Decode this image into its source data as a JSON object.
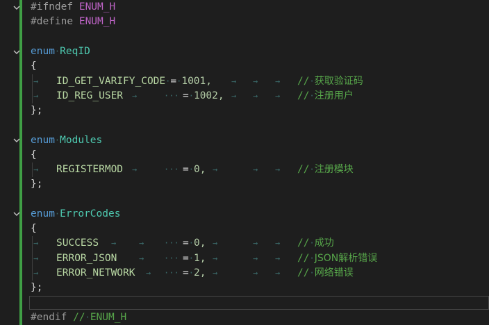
{
  "editor": {
    "colors": {
      "background": "#1e1e1e",
      "change_bar": "#3f9f45",
      "keyword": "#569cd6",
      "type": "#4ec9b0",
      "comment": "#57a64a",
      "macro": "#bd63c5"
    }
  },
  "lines": {
    "l1": {
      "d": "#ifndef",
      "name": "ENUM_H"
    },
    "l2": {
      "d": "#define",
      "name": "ENUM_H"
    },
    "l4": {
      "kw": "enum",
      "name": "ReqID"
    },
    "l5": {
      "t": "{"
    },
    "l6": {
      "name": "ID_GET_VARIFY_CODE",
      "eq": "=",
      "val": "1001,",
      "c1": "//",
      "c2": "获取验证码"
    },
    "l7": {
      "name": "ID_REG_USER",
      "eq": "=",
      "val": "1002,",
      "c1": "//",
      "c2": "注册用户"
    },
    "l8": {
      "t": "};"
    },
    "l10": {
      "kw": "enum",
      "name": "Modules"
    },
    "l11": {
      "t": "{"
    },
    "l12": {
      "name": "REGISTERMOD",
      "eq": "=",
      "val": "0,",
      "c1": "//",
      "c2": "注册模块"
    },
    "l13": {
      "t": "};"
    },
    "l15": {
      "kw": "enum",
      "name": "ErrorCodes"
    },
    "l16": {
      "t": "{"
    },
    "l17": {
      "name": "SUCCESS",
      "eq": "=",
      "val": "0,",
      "c1": "//",
      "c2": "成功"
    },
    "l18": {
      "name": "ERROR_JSON",
      "eq": "=",
      "val": "1,",
      "c1": "//",
      "c2": "JSON解析错误"
    },
    "l19": {
      "name": "ERROR_NETWORK",
      "eq": "=",
      "val": "2,",
      "c1": "//",
      "c2": "网络错误"
    },
    "l20": {
      "t": "};"
    },
    "l22": {
      "d": "#endif",
      "c1": "//",
      "name": "ENUM_H"
    }
  }
}
